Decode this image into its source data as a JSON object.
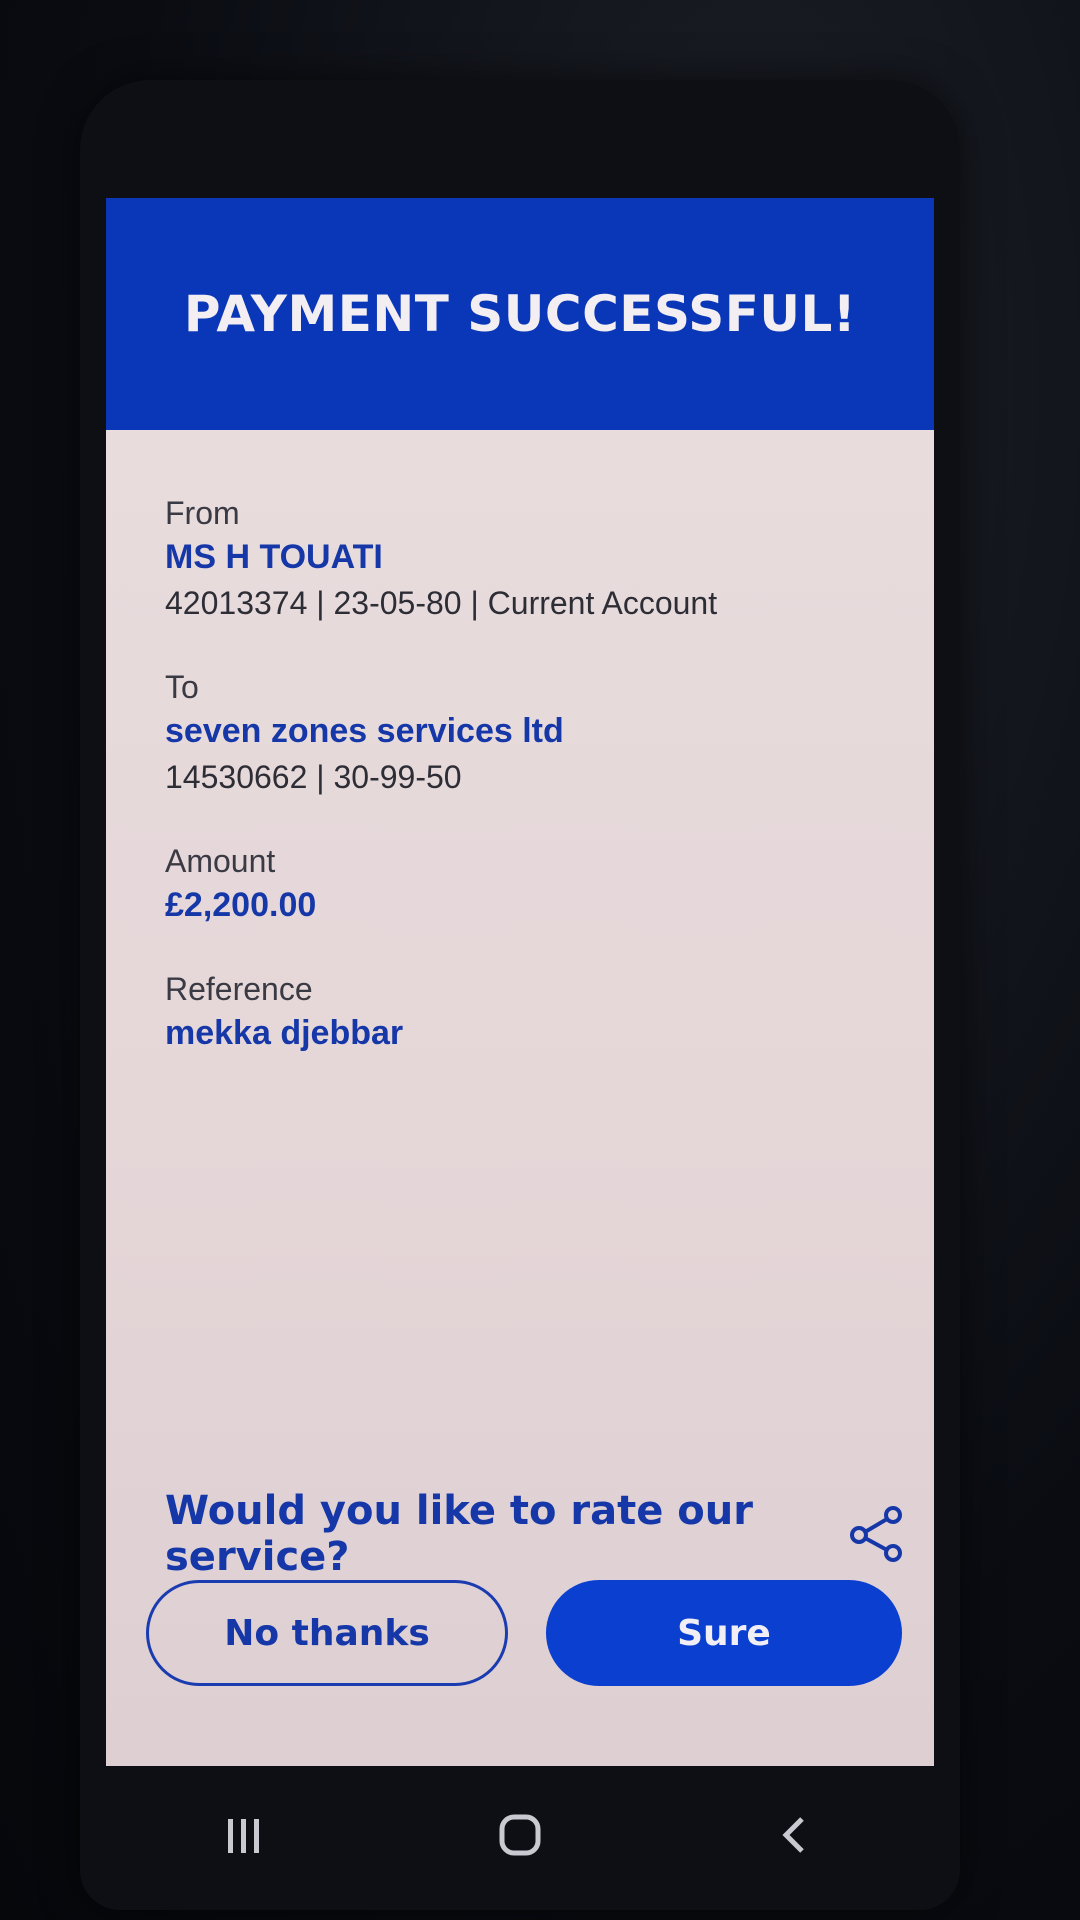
{
  "header": {
    "title": "PAYMENT SUCCESSFUL!"
  },
  "from": {
    "label": "From",
    "name": "MS H TOUATI",
    "details": "42013374 | 23-05-80 | Current Account"
  },
  "to": {
    "label": "To",
    "name": "seven zones services ltd",
    "details": "14530662 | 30-99-50"
  },
  "amount": {
    "label": "Amount",
    "value": "£2,200.00"
  },
  "reference": {
    "label": "Reference",
    "value": "mekka djebbar"
  },
  "rating": {
    "question": "Would you like to rate our service?",
    "share_icon": "share-icon",
    "decline_label": "No thanks",
    "accept_label": "Sure"
  },
  "navbar": {
    "recents_icon": "recents-icon",
    "home_icon": "home-icon",
    "back_icon": "back-icon"
  },
  "colors": {
    "brand_blue": "#0a36b8",
    "accent_blue": "#1537a8",
    "screen_bg": "#e9dede"
  }
}
